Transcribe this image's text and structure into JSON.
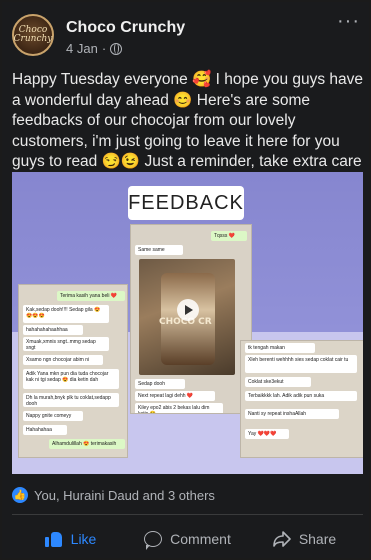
{
  "post": {
    "page_name": "Choco Crunchy",
    "avatar_text": "Choco\nCrunchy",
    "date": "4 Jan",
    "more_icon": "more-dots-icon",
    "body": "Happy Tuesday everyone 🥰 I hope you guys have a wonderful day ahead 😊 Here's are some feedbacks of our chocojar from our lovely customers, i'm just going to leave it here for you guys to read 😏😉 Just a reminder, take extra care and stay safe ❤️"
  },
  "media": {
    "title": "FEEDBACK",
    "jar_label": "CHOCO CR",
    "left_chat": [
      "Terima kasih yana beli ❤️",
      "Kak,sedap dooh!!!! Sedap gila 😍😍😍😍",
      "hahahahahaahhaa",
      "Xmuak,xmnis sngt..mmg sedap sngt",
      "Xsamo ngn chocojar abim ni",
      "Adik Yana mkn pun dia tuda chocojar kak ni tgi sedap 😍 dia ketin dah",
      "Dh la murah,bnyk plk tu coklat,sedapp dooh",
      "Nappy gnite comeyy",
      "Hahahahaa",
      "Alhamdulillah 😍 terimakasih"
    ],
    "mid_chat": [
      "Tqsss ❤️",
      "Same same",
      "Sedap dooh",
      "Next repeat lagi dehh ❤️",
      "Kiley epo2 abis 2 bekas lalu dim ketis 😂"
    ],
    "right_chat": [
      "tk tengah makan",
      "Xleh berenti wehhhh sies sedap coklat cair tu",
      "Coklat ske3ekut",
      "Terbaikkkk lah. Adik adik pun suka",
      "Nanti sy repeat inshaAllah",
      "Yay ❤️❤️❤️"
    ]
  },
  "reactions": {
    "summary": "You, Huraini Daud and 3 others",
    "icon": "like-reaction-icon"
  },
  "actions": {
    "like": "Like",
    "comment": "Comment",
    "share": "Share"
  },
  "colors": {
    "background": "#1a1b1d",
    "text": "#e9e9e9",
    "muted": "#b0b3b8",
    "accent": "#2d88ff"
  }
}
